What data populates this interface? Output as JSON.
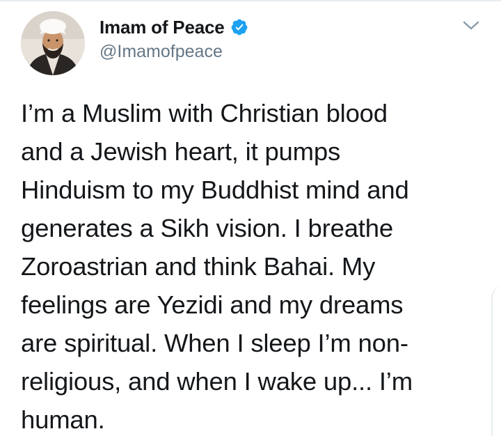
{
  "tweet": {
    "author": {
      "display_name": "Imam of Peace",
      "handle": "@Imamofpeace",
      "verified": true,
      "avatar_icon": "avatar"
    },
    "menu_icon": "chevron-down-icon",
    "text": "I’m a Muslim with Christian blood\nand a Jewish heart, it pumps\nHinduism to my Buddhist mind and\ngenerates a Sikh vision. I breathe\nZoroastrian and think Bahai. My\nfeelings are Yezidi and my dreams\nare spiritual. When I sleep I’m non-\nreligious, and when I wake up... I’m\nhuman."
  },
  "colors": {
    "verified": "#1da1f2",
    "handle": "#657786",
    "text": "#14171a",
    "caret": "#8899a6"
  }
}
